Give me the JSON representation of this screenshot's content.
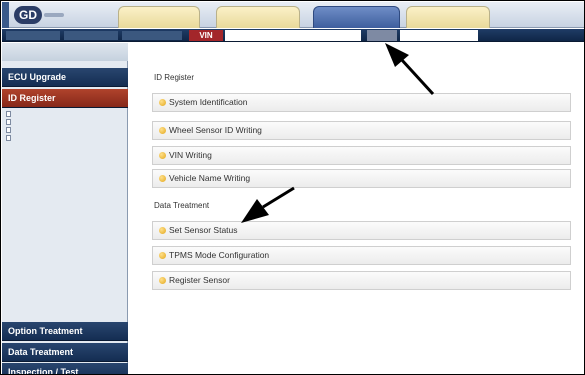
{
  "header": {
    "tabs": [
      {
        "label": "",
        "active": false
      },
      {
        "label": "",
        "active": false
      },
      {
        "label": "",
        "active": true
      },
      {
        "label": "",
        "active": false
      }
    ],
    "user_info": ""
  },
  "vin_bar": {
    "vin_label": "VIN",
    "vin_value": "",
    "search_label": "",
    "search_value": "",
    "links": ""
  },
  "sidebar": {
    "head": "",
    "ecu_upgrade": "ECU Upgrade",
    "id_register": "ID Register",
    "subitems": [
      "",
      "",
      "",
      ""
    ],
    "option_treatment": "Option Treatment",
    "data_treatment": "Data Treatment",
    "inspection_test": "Inspection / Test"
  },
  "main": {
    "id_register_title": "ID Register",
    "id_items": [
      "System Identification",
      "Wheel Sensor ID Writing",
      "VIN Writing",
      "Vehicle Name Writing"
    ],
    "data_treatment_title": "Data Treatment",
    "data_items": [
      "Set Sensor Status",
      "TPMS Mode Configuration",
      "Register Sensor"
    ]
  },
  "colors": {
    "nav_dark": "#142d52",
    "active_red": "#a3262a",
    "tab_gold": "#e8d99a",
    "bullet": "#e3a71c"
  }
}
